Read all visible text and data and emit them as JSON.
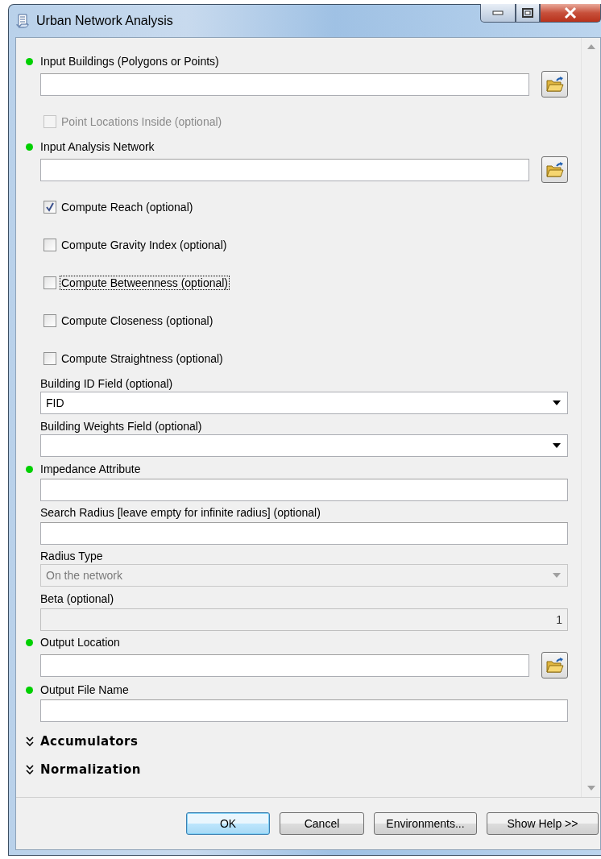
{
  "window": {
    "title": "Urban Network Analysis"
  },
  "parameters": [
    {
      "kind": "field",
      "label": "Input Buildings (Polygons or Points)",
      "required": true,
      "browse": true
    },
    {
      "kind": "checkbox",
      "label": "Point Locations Inside (optional)",
      "checked": false,
      "disabled": true,
      "focused": false
    },
    {
      "kind": "field",
      "label": "Input Analysis Network",
      "required": true,
      "browse": true
    },
    {
      "kind": "checkbox",
      "label": "Compute Reach (optional)",
      "checked": true,
      "disabled": false,
      "focused": false
    },
    {
      "kind": "checkbox",
      "label": "Compute Gravity Index (optional)",
      "checked": false,
      "disabled": false,
      "focused": false
    },
    {
      "kind": "checkbox",
      "label": "Compute Betweenness (optional)",
      "checked": false,
      "disabled": false,
      "focused": true
    },
    {
      "kind": "checkbox",
      "label": "Compute Closeness (optional)",
      "checked": false,
      "disabled": false,
      "focused": false
    },
    {
      "kind": "checkbox",
      "label": "Compute Straightness (optional)",
      "checked": false,
      "disabled": false,
      "focused": false
    },
    {
      "kind": "dropdown",
      "label": "Building ID Field (optional)",
      "required": false,
      "value": "FID",
      "disabled": false
    },
    {
      "kind": "dropdown",
      "label": "Building Weights Field (optional)",
      "required": false,
      "disabled": false
    },
    {
      "kind": "field",
      "label": "Impedance Attribute",
      "required": true,
      "browse": false
    },
    {
      "kind": "field",
      "label": "Search Radius [leave empty for infinite radius] (optional)",
      "required": false,
      "browse": false
    },
    {
      "kind": "dropdown",
      "label": "Radius Type",
      "required": false,
      "value": "On the network",
      "disabled": true
    },
    {
      "kind": "field",
      "label": "Beta (optional)",
      "required": false,
      "browse": false,
      "value": "1",
      "disabled": true
    },
    {
      "kind": "field",
      "label": "Output Location",
      "required": true,
      "browse": true
    },
    {
      "kind": "field",
      "label": "Output File Name",
      "required": true,
      "browse": false
    },
    {
      "kind": "section",
      "label": "Accumulators",
      "expanded": false
    },
    {
      "kind": "section",
      "label": "Normalization",
      "expanded": false
    }
  ],
  "buttons": [
    {
      "label": "OK",
      "default": true
    },
    {
      "label": "Cancel",
      "default": false
    },
    {
      "label": "Environments...",
      "default": false
    },
    {
      "label": "Show Help >>",
      "default": false
    }
  ]
}
